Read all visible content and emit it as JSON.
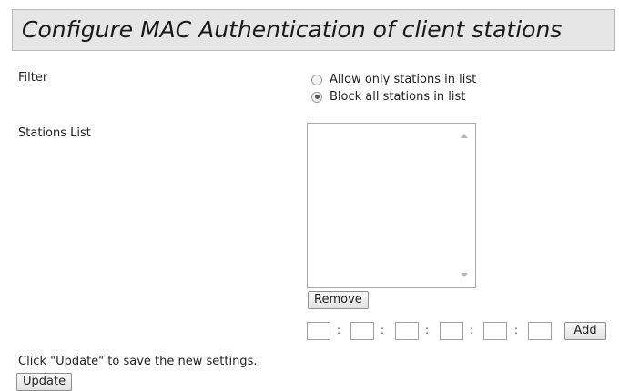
{
  "title": "Configure MAC Authentication of client stations",
  "filter": {
    "label": "Filter",
    "options": [
      {
        "label": "Allow only stations in list",
        "checked": false
      },
      {
        "label": "Block all stations in list",
        "checked": true
      }
    ]
  },
  "stations": {
    "label": "Stations List",
    "items": [],
    "remove_label": "Remove"
  },
  "mac_entry": {
    "octets": [
      "",
      "",
      "",
      "",
      "",
      ""
    ],
    "separator": ":",
    "add_label": "Add"
  },
  "footer": {
    "hint": "Click \"Update\" to save the new settings.",
    "update_label": "Update"
  }
}
